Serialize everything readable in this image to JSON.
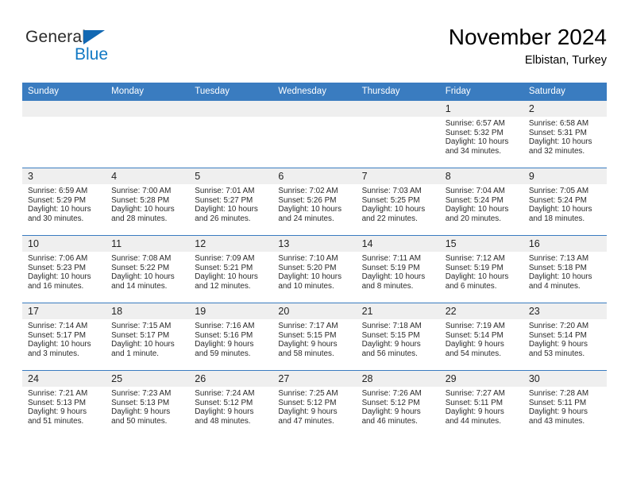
{
  "brand": {
    "name_top": "General",
    "name_bottom": "Blue",
    "accent_color": "#1279c4",
    "triangle_color": "#1268b3"
  },
  "header": {
    "month_title": "November 2024",
    "location": "Elbistan, Turkey"
  },
  "theme": {
    "header_row_bg": "#3a7cc0",
    "daynum_bg": "#efefef",
    "row_border": "#3a7cc0",
    "text": "#2a2a2a"
  },
  "weekday_headers": [
    "Sunday",
    "Monday",
    "Tuesday",
    "Wednesday",
    "Thursday",
    "Friday",
    "Saturday"
  ],
  "weeks": [
    [
      {
        "day": "",
        "sunrise": "",
        "sunset": "",
        "daylight_1": "",
        "daylight_2": "",
        "blank": true
      },
      {
        "day": "",
        "sunrise": "",
        "sunset": "",
        "daylight_1": "",
        "daylight_2": "",
        "blank": true
      },
      {
        "day": "",
        "sunrise": "",
        "sunset": "",
        "daylight_1": "",
        "daylight_2": "",
        "blank": true
      },
      {
        "day": "",
        "sunrise": "",
        "sunset": "",
        "daylight_1": "",
        "daylight_2": "",
        "blank": true
      },
      {
        "day": "",
        "sunrise": "",
        "sunset": "",
        "daylight_1": "",
        "daylight_2": "",
        "blank": true
      },
      {
        "day": "1",
        "sunrise": "Sunrise: 6:57 AM",
        "sunset": "Sunset: 5:32 PM",
        "daylight_1": "Daylight: 10 hours",
        "daylight_2": "and 34 minutes.",
        "blank": false
      },
      {
        "day": "2",
        "sunrise": "Sunrise: 6:58 AM",
        "sunset": "Sunset: 5:31 PM",
        "daylight_1": "Daylight: 10 hours",
        "daylight_2": "and 32 minutes.",
        "blank": false
      }
    ],
    [
      {
        "day": "3",
        "sunrise": "Sunrise: 6:59 AM",
        "sunset": "Sunset: 5:29 PM",
        "daylight_1": "Daylight: 10 hours",
        "daylight_2": "and 30 minutes.",
        "blank": false
      },
      {
        "day": "4",
        "sunrise": "Sunrise: 7:00 AM",
        "sunset": "Sunset: 5:28 PM",
        "daylight_1": "Daylight: 10 hours",
        "daylight_2": "and 28 minutes.",
        "blank": false
      },
      {
        "day": "5",
        "sunrise": "Sunrise: 7:01 AM",
        "sunset": "Sunset: 5:27 PM",
        "daylight_1": "Daylight: 10 hours",
        "daylight_2": "and 26 minutes.",
        "blank": false
      },
      {
        "day": "6",
        "sunrise": "Sunrise: 7:02 AM",
        "sunset": "Sunset: 5:26 PM",
        "daylight_1": "Daylight: 10 hours",
        "daylight_2": "and 24 minutes.",
        "blank": false
      },
      {
        "day": "7",
        "sunrise": "Sunrise: 7:03 AM",
        "sunset": "Sunset: 5:25 PM",
        "daylight_1": "Daylight: 10 hours",
        "daylight_2": "and 22 minutes.",
        "blank": false
      },
      {
        "day": "8",
        "sunrise": "Sunrise: 7:04 AM",
        "sunset": "Sunset: 5:24 PM",
        "daylight_1": "Daylight: 10 hours",
        "daylight_2": "and 20 minutes.",
        "blank": false
      },
      {
        "day": "9",
        "sunrise": "Sunrise: 7:05 AM",
        "sunset": "Sunset: 5:24 PM",
        "daylight_1": "Daylight: 10 hours",
        "daylight_2": "and 18 minutes.",
        "blank": false
      }
    ],
    [
      {
        "day": "10",
        "sunrise": "Sunrise: 7:06 AM",
        "sunset": "Sunset: 5:23 PM",
        "daylight_1": "Daylight: 10 hours",
        "daylight_2": "and 16 minutes.",
        "blank": false
      },
      {
        "day": "11",
        "sunrise": "Sunrise: 7:08 AM",
        "sunset": "Sunset: 5:22 PM",
        "daylight_1": "Daylight: 10 hours",
        "daylight_2": "and 14 minutes.",
        "blank": false
      },
      {
        "day": "12",
        "sunrise": "Sunrise: 7:09 AM",
        "sunset": "Sunset: 5:21 PM",
        "daylight_1": "Daylight: 10 hours",
        "daylight_2": "and 12 minutes.",
        "blank": false
      },
      {
        "day": "13",
        "sunrise": "Sunrise: 7:10 AM",
        "sunset": "Sunset: 5:20 PM",
        "daylight_1": "Daylight: 10 hours",
        "daylight_2": "and 10 minutes.",
        "blank": false
      },
      {
        "day": "14",
        "sunrise": "Sunrise: 7:11 AM",
        "sunset": "Sunset: 5:19 PM",
        "daylight_1": "Daylight: 10 hours",
        "daylight_2": "and 8 minutes.",
        "blank": false
      },
      {
        "day": "15",
        "sunrise": "Sunrise: 7:12 AM",
        "sunset": "Sunset: 5:19 PM",
        "daylight_1": "Daylight: 10 hours",
        "daylight_2": "and 6 minutes.",
        "blank": false
      },
      {
        "day": "16",
        "sunrise": "Sunrise: 7:13 AM",
        "sunset": "Sunset: 5:18 PM",
        "daylight_1": "Daylight: 10 hours",
        "daylight_2": "and 4 minutes.",
        "blank": false
      }
    ],
    [
      {
        "day": "17",
        "sunrise": "Sunrise: 7:14 AM",
        "sunset": "Sunset: 5:17 PM",
        "daylight_1": "Daylight: 10 hours",
        "daylight_2": "and 3 minutes.",
        "blank": false
      },
      {
        "day": "18",
        "sunrise": "Sunrise: 7:15 AM",
        "sunset": "Sunset: 5:17 PM",
        "daylight_1": "Daylight: 10 hours",
        "daylight_2": "and 1 minute.",
        "blank": false
      },
      {
        "day": "19",
        "sunrise": "Sunrise: 7:16 AM",
        "sunset": "Sunset: 5:16 PM",
        "daylight_1": "Daylight: 9 hours",
        "daylight_2": "and 59 minutes.",
        "blank": false
      },
      {
        "day": "20",
        "sunrise": "Sunrise: 7:17 AM",
        "sunset": "Sunset: 5:15 PM",
        "daylight_1": "Daylight: 9 hours",
        "daylight_2": "and 58 minutes.",
        "blank": false
      },
      {
        "day": "21",
        "sunrise": "Sunrise: 7:18 AM",
        "sunset": "Sunset: 5:15 PM",
        "daylight_1": "Daylight: 9 hours",
        "daylight_2": "and 56 minutes.",
        "blank": false
      },
      {
        "day": "22",
        "sunrise": "Sunrise: 7:19 AM",
        "sunset": "Sunset: 5:14 PM",
        "daylight_1": "Daylight: 9 hours",
        "daylight_2": "and 54 minutes.",
        "blank": false
      },
      {
        "day": "23",
        "sunrise": "Sunrise: 7:20 AM",
        "sunset": "Sunset: 5:14 PM",
        "daylight_1": "Daylight: 9 hours",
        "daylight_2": "and 53 minutes.",
        "blank": false
      }
    ],
    [
      {
        "day": "24",
        "sunrise": "Sunrise: 7:21 AM",
        "sunset": "Sunset: 5:13 PM",
        "daylight_1": "Daylight: 9 hours",
        "daylight_2": "and 51 minutes.",
        "blank": false
      },
      {
        "day": "25",
        "sunrise": "Sunrise: 7:23 AM",
        "sunset": "Sunset: 5:13 PM",
        "daylight_1": "Daylight: 9 hours",
        "daylight_2": "and 50 minutes.",
        "blank": false
      },
      {
        "day": "26",
        "sunrise": "Sunrise: 7:24 AM",
        "sunset": "Sunset: 5:12 PM",
        "daylight_1": "Daylight: 9 hours",
        "daylight_2": "and 48 minutes.",
        "blank": false
      },
      {
        "day": "27",
        "sunrise": "Sunrise: 7:25 AM",
        "sunset": "Sunset: 5:12 PM",
        "daylight_1": "Daylight: 9 hours",
        "daylight_2": "and 47 minutes.",
        "blank": false
      },
      {
        "day": "28",
        "sunrise": "Sunrise: 7:26 AM",
        "sunset": "Sunset: 5:12 PM",
        "daylight_1": "Daylight: 9 hours",
        "daylight_2": "and 46 minutes.",
        "blank": false
      },
      {
        "day": "29",
        "sunrise": "Sunrise: 7:27 AM",
        "sunset": "Sunset: 5:11 PM",
        "daylight_1": "Daylight: 9 hours",
        "daylight_2": "and 44 minutes.",
        "blank": false
      },
      {
        "day": "30",
        "sunrise": "Sunrise: 7:28 AM",
        "sunset": "Sunset: 5:11 PM",
        "daylight_1": "Daylight: 9 hours",
        "daylight_2": "and 43 minutes.",
        "blank": false
      }
    ]
  ]
}
